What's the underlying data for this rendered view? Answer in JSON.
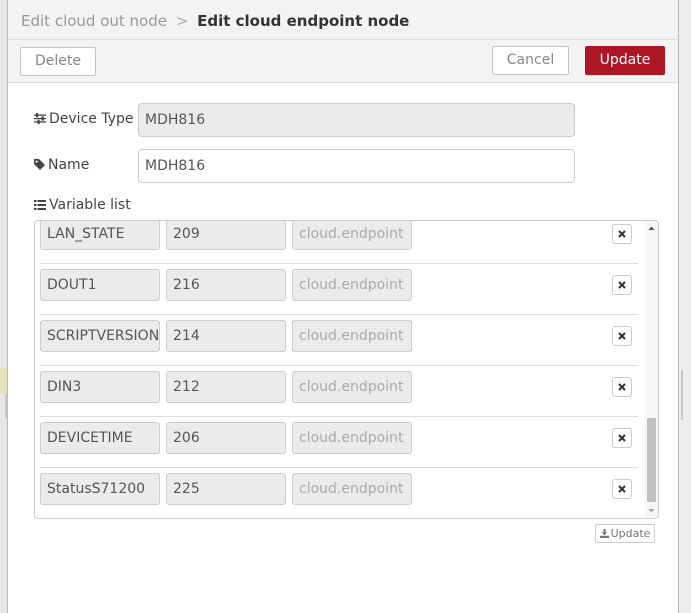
{
  "breadcrumb": {
    "parent": "Edit cloud out node",
    "separator": ">",
    "current": "Edit cloud endpoint node"
  },
  "toolbar": {
    "delete_label": "Delete",
    "cancel_label": "Cancel",
    "update_label": "Update"
  },
  "form": {
    "device_type_label": "Device Type",
    "device_type_value": "MDH816",
    "name_label": "Name",
    "name_value": "MDH816",
    "variable_list_label": "Variable list"
  },
  "variables": [
    {
      "name": "LAN_STATE",
      "id": "209",
      "target": "cloud.endpoint"
    },
    {
      "name": "DOUT1",
      "id": "216",
      "target": "cloud.endpoint"
    },
    {
      "name": "SCRIPTVERSION",
      "id": "214",
      "target": "cloud.endpoint"
    },
    {
      "name": "DIN3",
      "id": "212",
      "target": "cloud.endpoint"
    },
    {
      "name": "DEVICETIME",
      "id": "206",
      "target": "cloud.endpoint"
    },
    {
      "name": "StatusS71200",
      "id": "225",
      "target": "cloud.endpoint"
    }
  ],
  "list_update_label": "Update",
  "colors": {
    "primary": "#ad1625",
    "header_bg": "#f3f3f3",
    "border": "#cccccc"
  },
  "icons": {
    "device_type": "sliders-icon",
    "name": "tag-icon",
    "variable_list": "list-icon",
    "remove": "close-icon",
    "small_update": "download-icon"
  }
}
